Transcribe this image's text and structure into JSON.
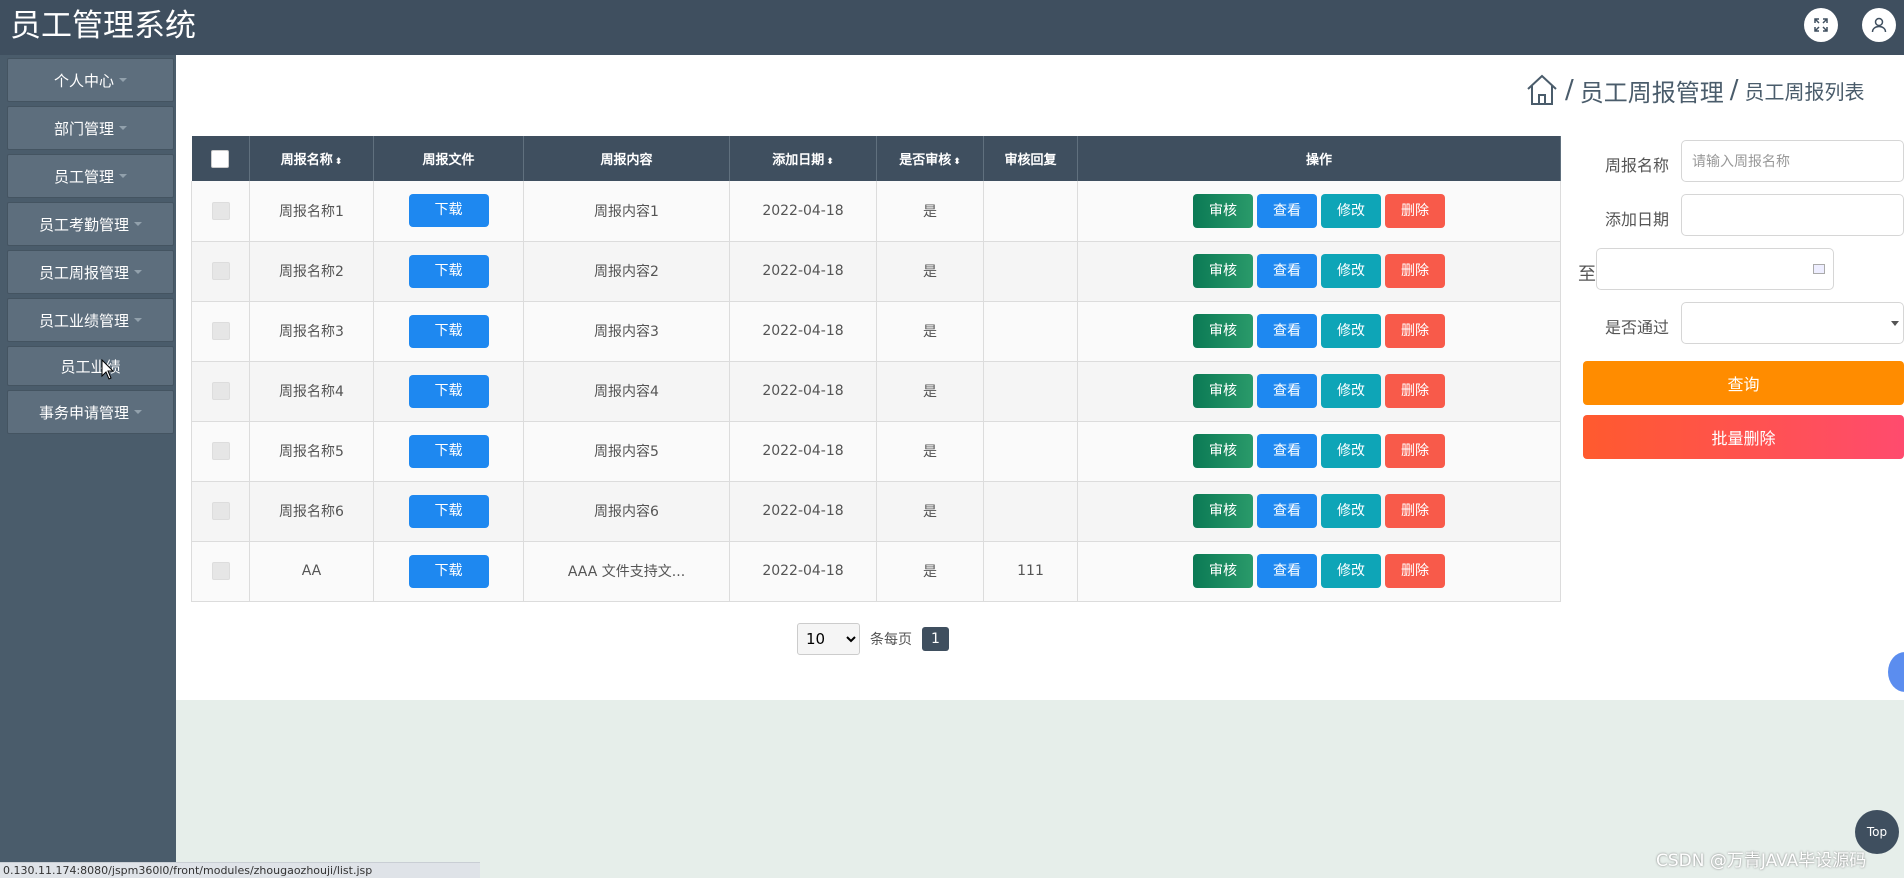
{
  "header": {
    "title": "员工管理系统",
    "fullscreen_icon": "fullscreen-icon",
    "user_icon": "user-icon"
  },
  "sidebar": {
    "items": [
      {
        "label": "个人中心"
      },
      {
        "label": "部门管理"
      },
      {
        "label": "员工管理"
      },
      {
        "label": "员工考勤管理"
      },
      {
        "label": "员工周报管理"
      },
      {
        "label": "员工业绩管理"
      },
      {
        "label": "员工业绩"
      },
      {
        "label": "事务申请管理"
      }
    ]
  },
  "breadcrumb": {
    "home_icon": "home-icon",
    "sep": "/",
    "main": "员工周报管理",
    "current": "员工周报列表"
  },
  "table": {
    "columns": [
      "周报名称",
      "周报文件",
      "周报内容",
      "添加日期",
      "是否审核",
      "审核回复",
      "操作"
    ],
    "sort_arrows": "⬍",
    "rows": [
      {
        "name": "周报名称1",
        "download": "下载",
        "content": "周报内容1",
        "date": "2022-04-18",
        "reviewed": "是",
        "reply": ""
      },
      {
        "name": "周报名称2",
        "download": "下载",
        "content": "周报内容2",
        "date": "2022-04-18",
        "reviewed": "是",
        "reply": ""
      },
      {
        "name": "周报名称3",
        "download": "下载",
        "content": "周报内容3",
        "date": "2022-04-18",
        "reviewed": "是",
        "reply": ""
      },
      {
        "name": "周报名称4",
        "download": "下载",
        "content": "周报内容4",
        "date": "2022-04-18",
        "reviewed": "是",
        "reply": ""
      },
      {
        "name": "周报名称5",
        "download": "下载",
        "content": "周报内容5",
        "date": "2022-04-18",
        "reviewed": "是",
        "reply": ""
      },
      {
        "name": "周报名称6",
        "download": "下载",
        "content": "周报内容6",
        "date": "2022-04-18",
        "reviewed": "是",
        "reply": ""
      },
      {
        "name": "AA",
        "download": "下载",
        "content": "AAA 文件支持文...",
        "date": "2022-04-18",
        "reviewed": "是",
        "reply": "111"
      }
    ],
    "actions": {
      "review": "审核",
      "view": "查看",
      "edit": "修改",
      "delete": "删除"
    },
    "action_colors": {
      "review": "#0b7a55",
      "view": "#1e88f0",
      "edit": "#0ea5b7",
      "delete": "#f85a4a"
    }
  },
  "pager": {
    "page_size": "10",
    "per_page_label": "条每页",
    "current_page": "1"
  },
  "search_form": {
    "name_label": "周报名称",
    "name_placeholder": "请输入周报名称",
    "date_label": "添加日期",
    "to_label": "至",
    "passed_label": "是否通过",
    "search_button": "查询",
    "batch_delete_button": "批量删除"
  },
  "footer": {
    "top_button": "Top",
    "watermark": "CSDN @万青JAVA毕设源码",
    "status_url": "0.130.11.174:8080/jspm360l0/front/modules/zhougaozhouji/list.jsp"
  },
  "colors": {
    "header": "#3f4f5f",
    "sidebar": "#4a5c6b",
    "search": "#ff8c00",
    "batch_delete": "#ff5a2e"
  }
}
